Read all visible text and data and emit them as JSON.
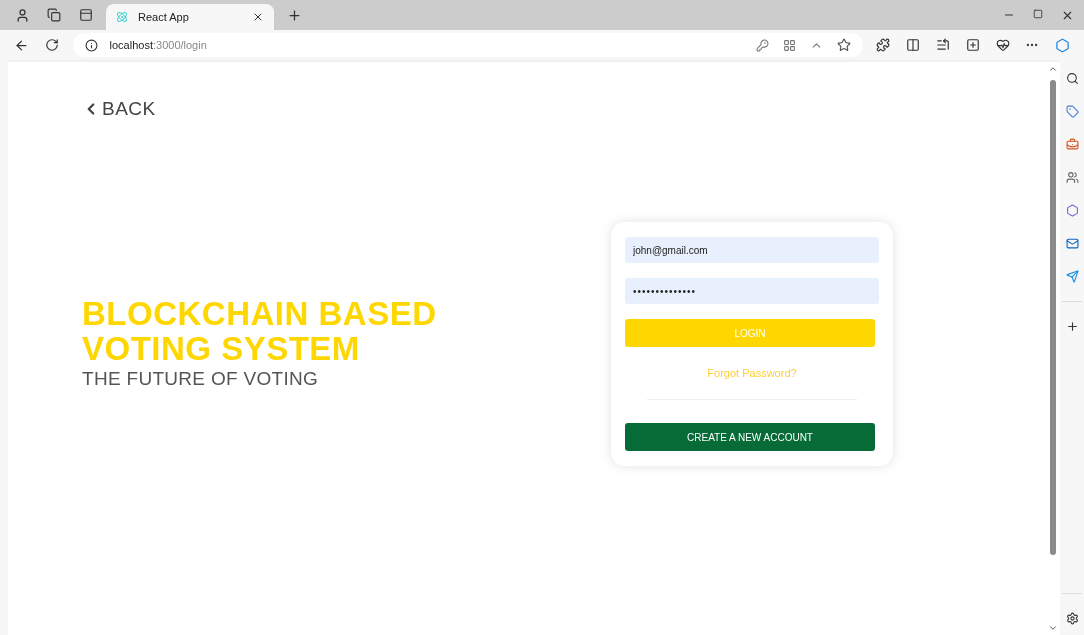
{
  "browser": {
    "tab": {
      "title": "React App",
      "selected": true
    },
    "url": {
      "host": "localhost",
      "path": ":3000/login"
    }
  },
  "page": {
    "back": {
      "label": "BACK"
    },
    "hero": {
      "title_lines": [
        "BLOCKCHAIN BASED",
        "VOTING SYSTEM"
      ],
      "subtitle": "THE FUTURE OF VOTING"
    },
    "form": {
      "fields": [
        {
          "kind": "email",
          "value": "john@gmail.com"
        },
        {
          "kind": "password",
          "value": "••••••••••••••"
        }
      ],
      "login_button": "LOGIN",
      "forgot_link": "Forgot Password?",
      "create_button": "CREATE A NEW ACCOUNT"
    }
  }
}
